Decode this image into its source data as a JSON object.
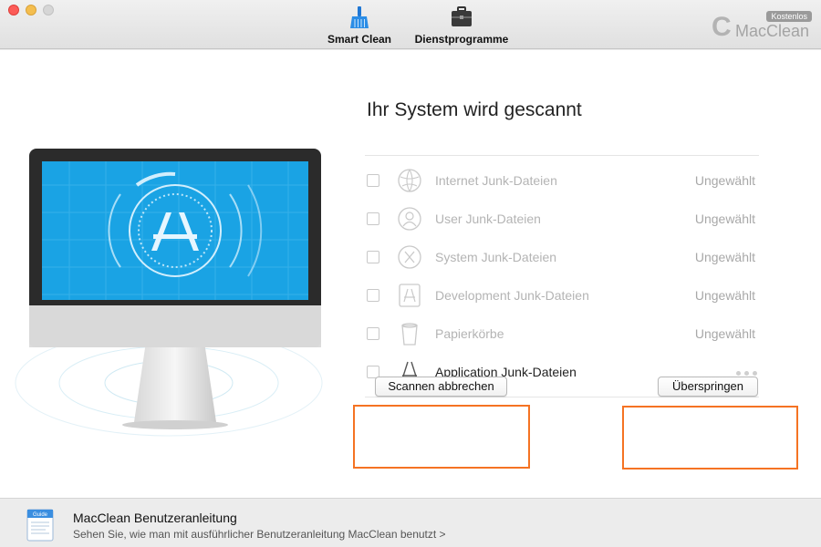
{
  "window": {
    "controls": [
      "close",
      "minimize",
      "zoom"
    ]
  },
  "toolbar": {
    "items": [
      {
        "label": "Smart Clean",
        "icon": "broom-icon"
      },
      {
        "label": "Dienstprogramme",
        "icon": "toolbox-icon"
      }
    ]
  },
  "brand": {
    "badge": "Kostenlos",
    "name": "MacClean"
  },
  "scan": {
    "title": "Ihr System wird gescannt",
    "items": [
      {
        "label": "Internet Junk-Dateien",
        "status": "Ungewählt",
        "icon": "globe-icon"
      },
      {
        "label": "User Junk-Dateien",
        "status": "Ungewählt",
        "icon": "user-icon"
      },
      {
        "label": "System Junk-Dateien",
        "status": "Ungewählt",
        "icon": "x-circle-icon"
      },
      {
        "label": "Development Junk-Dateien",
        "status": "Ungewählt",
        "icon": "app-icon"
      },
      {
        "label": "Papierkörbe",
        "status": "Ungewählt",
        "icon": "trash-icon"
      },
      {
        "label": "Application Junk-Dateien",
        "status": "",
        "icon": "app-store-icon"
      }
    ]
  },
  "buttons": {
    "cancel": "Scannen abbrechen",
    "skip": "Überspringen"
  },
  "footer": {
    "icon_label": "Guide",
    "title": "MacClean Benutzeranleitung",
    "link": "Sehen Sie, wie man mit ausführlicher Benutzeranleitung MacClean benutzt >"
  },
  "colors": {
    "highlight": "#f57323",
    "screen": "#1aa3e4"
  }
}
